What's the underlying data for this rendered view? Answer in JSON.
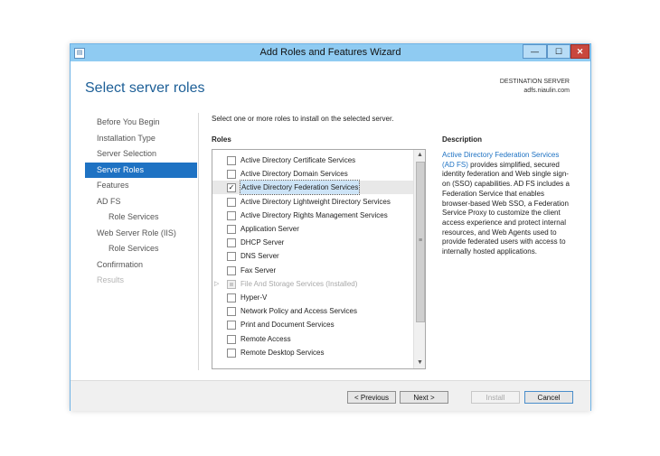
{
  "window": {
    "title": "Add Roles and Features Wizard"
  },
  "titlebar": {
    "minimize": "—",
    "maximize": "☐",
    "close": "✕",
    "icon": "wizard-icon"
  },
  "header": {
    "title": "Select server roles",
    "destination_label": "DESTINATION SERVER",
    "destination_server": "adfs.niaulin.com"
  },
  "nav": {
    "items": [
      {
        "label": "Before You Begin",
        "state": "normal"
      },
      {
        "label": "Installation Type",
        "state": "normal"
      },
      {
        "label": "Server Selection",
        "state": "normal"
      },
      {
        "label": "Server Roles",
        "state": "selected"
      },
      {
        "label": "Features",
        "state": "normal"
      },
      {
        "label": "AD FS",
        "state": "normal"
      },
      {
        "label": "Role Services",
        "state": "normal"
      },
      {
        "label": "Web Server Role (IIS)",
        "state": "normal"
      },
      {
        "label": "Role Services",
        "state": "normal"
      },
      {
        "label": "Confirmation",
        "state": "normal"
      },
      {
        "label": "Results",
        "state": "disabled"
      }
    ]
  },
  "main": {
    "instruction": "Select one or more roles to install on the selected server.",
    "roles_label": "Roles",
    "description_label": "Description",
    "roles": [
      {
        "label": "Active Directory Certificate Services",
        "checked": false
      },
      {
        "label": "Active Directory Domain Services",
        "checked": false
      },
      {
        "label": "Active Directory Federation Services",
        "checked": true,
        "selected": true
      },
      {
        "label": "Active Directory Lightweight Directory Services",
        "checked": false
      },
      {
        "label": "Active Directory Rights Management Services",
        "checked": false
      },
      {
        "label": "Application Server",
        "checked": false
      },
      {
        "label": "DHCP Server",
        "checked": false
      },
      {
        "label": "DNS Server",
        "checked": false
      },
      {
        "label": "Fax Server",
        "checked": false
      },
      {
        "label": "File And Storage Services (Installed)",
        "checked": "partial",
        "disabled": true,
        "expandable": true
      },
      {
        "label": "Hyper-V",
        "checked": false
      },
      {
        "label": "Network Policy and Access Services",
        "checked": false
      },
      {
        "label": "Print and Document Services",
        "checked": false
      },
      {
        "label": "Remote Access",
        "checked": false
      },
      {
        "label": "Remote Desktop Services",
        "checked": false
      }
    ],
    "description": {
      "link": "Active Directory Federation Services (AD FS)",
      "text": " provides simplified, secured identity federation and Web single sign-on (SSO) capabilities. AD FS includes a Federation Service that enables browser-based Web SSO, a Federation Service Proxy to customize the client access experience and protect internal resources, and Web Agents used to provide federated users with access to internally hosted applications."
    }
  },
  "footer": {
    "previous": "< Previous",
    "next": "Next >",
    "install": "Install",
    "cancel": "Cancel"
  }
}
